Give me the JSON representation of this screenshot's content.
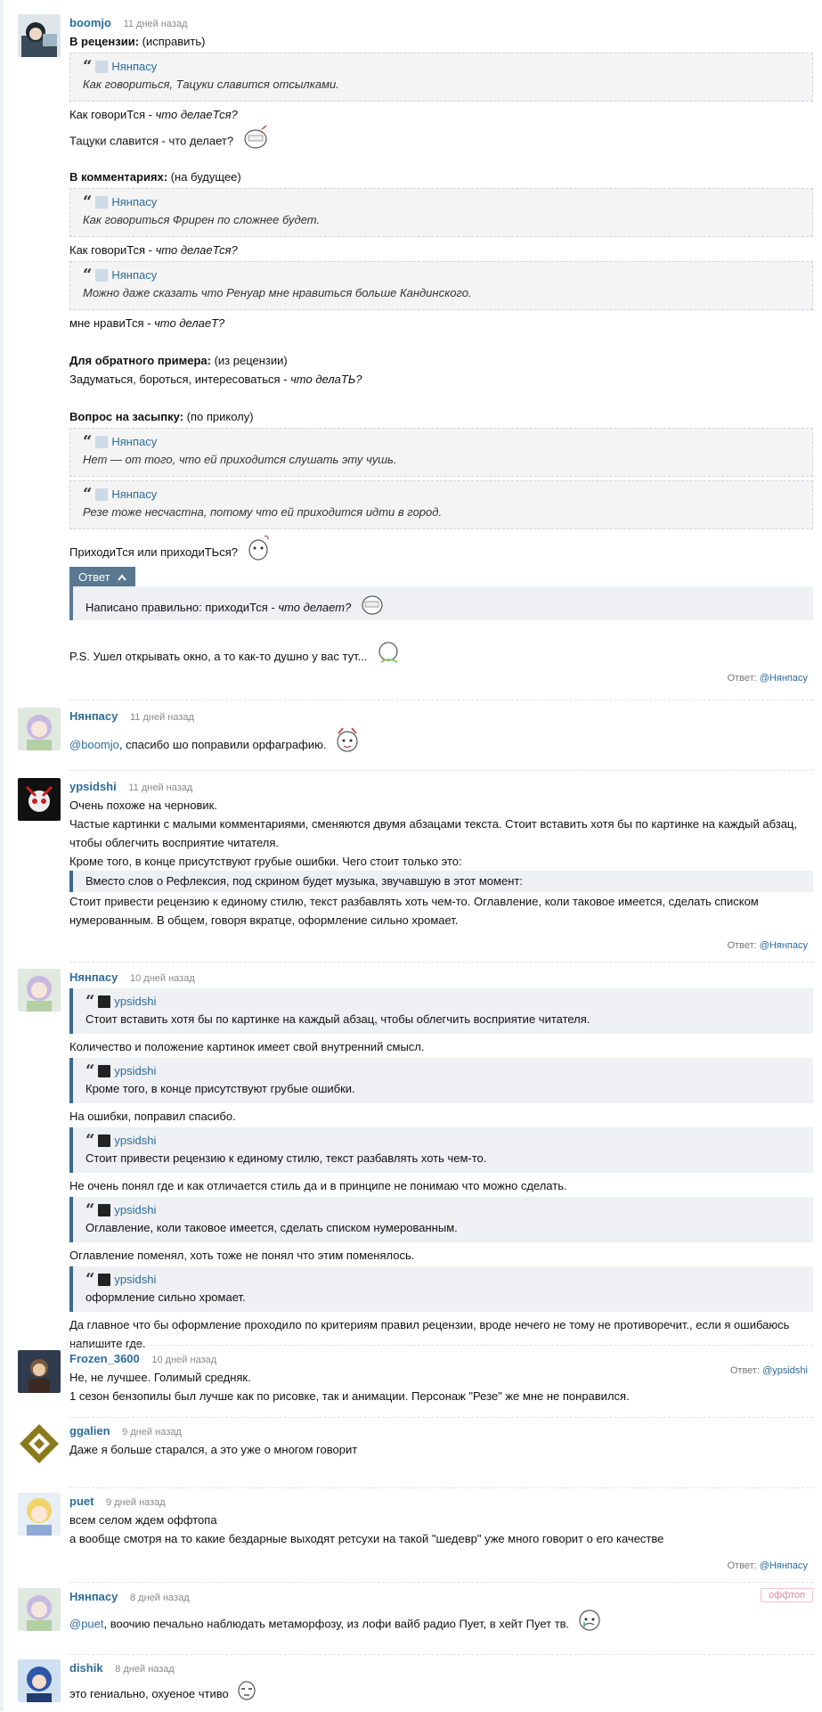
{
  "comments": {
    "c1": {
      "user": "boomjo",
      "time": "11 дней назад",
      "l1_bold": "В рецензии:",
      "l1_rest": " (исправить)",
      "q1_author": "Нянпасу",
      "q1_text": "Как говориться, Тацуки славится отсылками.",
      "l2_a": "Как говориТся - ",
      "l2_b": "что делаеТся?",
      "l3": "Тацуки славится - что делает?",
      "l4_bold": "В комментариях:",
      "l4_rest": " (на будущее)",
      "q2_author": "Нянпасу",
      "q2_text": "Как говориться Фрирен по сложнее будет.",
      "l5_a": "Как говориТся - ",
      "l5_b": "что делаеТся?",
      "q3_author": "Нянпасу",
      "q3_text": "Можно даже сказать что Ренуар мне нравиться больше Кандинского.",
      "l6_a": "мне нравиТся - ",
      "l6_b": "что делаеТ?",
      "l7_bold": "Для обратного примера:",
      "l7_rest": " (из рецензии)",
      "l8_a": "Задуматься, бороться, интересоваться - ",
      "l8_b": "что делаТЬ?",
      "l9_bold": "Вопрос на засыпку:",
      "l9_rest": " (по приколу)",
      "q4_author": "Нянпасу",
      "q4_text": "Нет — от того, что ей приходится слушать эту чушь.",
      "q5_author": "Нянпасу",
      "q5_text": "Резе тоже несчастна, потому что ей приходится идти в город.",
      "l10": "ПриходиТся или приходиТЬся?",
      "answer_label": "Ответ",
      "answer_a": "Написано правильно: приходиТся - ",
      "answer_b": "что делает?",
      "l11": "P.S. Ушел открывать окно, а то как-то душно у вас тут...",
      "reply_label": "Ответ: ",
      "reply_to": "@Нянпасу"
    },
    "c2": {
      "user": "Нянпасу",
      "time": "11 дней назад",
      "mention": "@boomjo",
      "text": ", спасибо шо поправили орфаграфию."
    },
    "c3": {
      "user": "ypsidshi",
      "time": "11 дней назад",
      "l1": "Очень похоже на черновик.",
      "l2": "Частые картинки с малыми комментариями, сменяются двумя абзацами текста. Стоит вставить хотя бы по картинке на каждый абзац,",
      "l3": "чтобы облегчить восприятие читателя.",
      "l4": "Кроме того, в конце присутствуют грубые ошибки. Чего стоит только это:",
      "q": "Вместо слов о Рефлексия, под скрином будет музыка, звучавшую в этот момент:",
      "l5": "Стоит привести рецензию к единому стилю, текст разбавлять хоть чем-то. Оглавление, коли таковое имеется, сделать списком",
      "l6": "нумерованным. В общем, говоря вкратце, оформление сильно хромает.",
      "reply_label": "Ответ: ",
      "reply_to": "@Нянпасу"
    },
    "c4": {
      "user": "Нянпасу",
      "time": "10 дней назад",
      "q1_author": "ypsidshi",
      "q1_text": "Стоит вставить хотя бы по картинке на каждый абзац, чтобы облегчить восприятие читателя.",
      "a1": "Количество и положение картинок имеет свой внутренний смысл.",
      "q2_author": "ypsidshi",
      "q2_text": "Кроме того, в конце присутствуют грубые ошибки.",
      "a2": "На ошибки, поправил спасибо.",
      "q3_author": "ypsidshi",
      "q3_text": "Стоит привести рецензию к единому стилю, текст разбавлять хоть чем-то.",
      "a3": "Не очень понял где и как отличается стиль да и в принципе не понимаю что можно сделать.",
      "q4_author": "ypsidshi",
      "q4_text": "Оглавление, коли таковое имеется, сделать списком нумерованным.",
      "a4": "Оглавление поменял, хоть тоже не понял что этим поменялось.",
      "q5_author": "ypsidshi",
      "q5_text": "оформление сильно хромает.",
      "a5": "Да главное что бы оформление проходило по критериям правил рецензии, вроде нечего не тому не противоречит., если я ошибаюсь",
      "a6": "напишите где.",
      "reply_label": "Ответ: ",
      "reply_to": "@ypsidshi"
    },
    "c5": {
      "user": "Frozen_3600",
      "time": "10 дней назад",
      "l1": "Не, не лучшее. Голимый средняк.",
      "l2": "1 сезон бензопилы был лучше как по рисовке, так и анимации. Персонаж \"Резе\" же мне не понравился."
    },
    "c6": {
      "user": "ggalien",
      "time": "9 дней назад",
      "l1": "Даже я больше старался, а это уже о многом говорит"
    },
    "c7": {
      "user": "puet",
      "time": "9 дней назад",
      "l1": "всем селом ждем оффтопа",
      "l2": "а вообще смотря на то какие бездарные выходят ретсухи на такой \"шедевр\" уже много говорит о его качестве",
      "reply_label": "Ответ: ",
      "reply_to": "@Нянпасу"
    },
    "c8": {
      "user": "Нянпасу",
      "time": "8 дней назад",
      "badge": "оффтоп",
      "mention": "@puet",
      "text": ", воочию печально наблюдать метаморфозу, из лофи вайб радио Пует, в хейт Пует тв."
    },
    "c9": {
      "user": "dishik",
      "time": "8 дней назад",
      "l1": "это гениально, охуеное чтиво"
    }
  },
  "icons": {
    "chevron": "chevron-up-icon",
    "quote": "quote-marks-icon"
  },
  "colors": {
    "link": "#2c6c9c",
    "answer_accent": "#5a7891",
    "offtop": "#e8879f"
  }
}
